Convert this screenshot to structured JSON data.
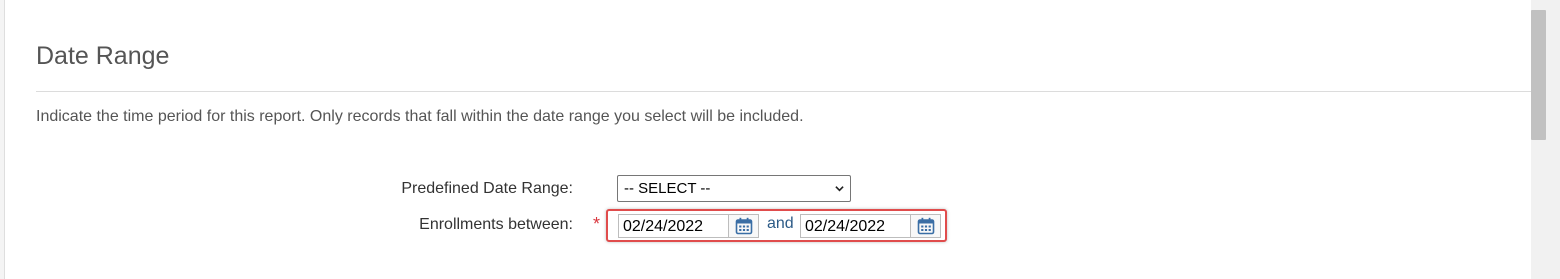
{
  "section": {
    "title": "Date Range",
    "description": "Indicate the time period for this report. Only records that fall within the date range you select will be included."
  },
  "form": {
    "predefined_label": "Predefined Date Range:",
    "predefined_value": "-- SELECT --",
    "enrollments_label": "Enrollments between:",
    "required_marker": "*",
    "start_date": "02/24/2022",
    "connector": "and",
    "end_date": "02/24/2022"
  },
  "colors": {
    "required": "#d9363e",
    "highlight_border": "#e04c4c",
    "calendar_icon": "#3a6ea5",
    "connector_text": "#2d5b87"
  },
  "icons": {
    "calendar": "calendar-icon",
    "dropdown": "chevron-down-icon"
  }
}
